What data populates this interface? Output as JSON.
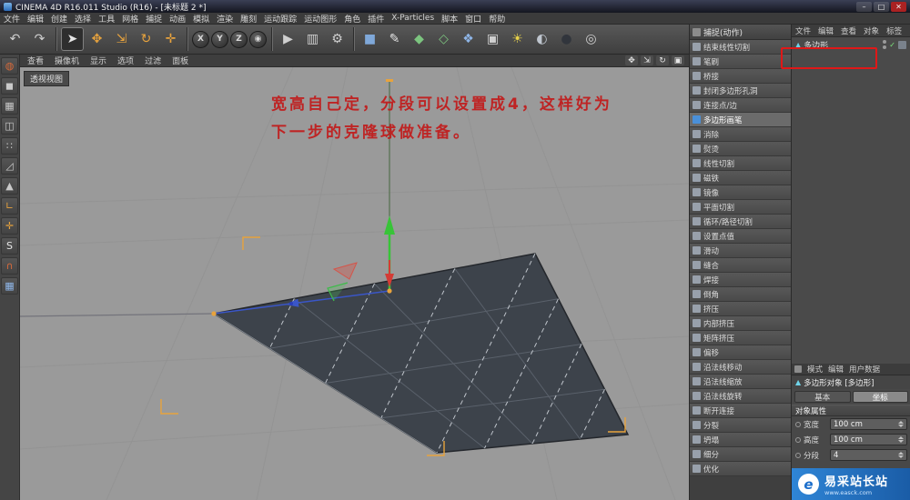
{
  "window": {
    "title": "CINEMA 4D R16.011 Studio (R16) - [未标题 2 *]",
    "minimize": "–",
    "maximize": "□",
    "close": "✕"
  },
  "menubar": {
    "items": [
      "文件",
      "编辑",
      "创建",
      "选择",
      "工具",
      "网格",
      "捕捉",
      "动画",
      "模拟",
      "渲染",
      "雕刻",
      "运动跟踪",
      "运动图形",
      "角色",
      "插件",
      "X-Particles",
      "脚本",
      "窗口",
      "帮助"
    ]
  },
  "toolbar": {
    "history": [
      {
        "name": "undo",
        "glyph": "↶",
        "color": "#cfcfcf"
      },
      {
        "name": "redo",
        "glyph": "↷",
        "color": "#cfcfcf"
      }
    ],
    "tools": [
      {
        "name": "live-selection",
        "glyph": "➤",
        "color": "#e6e6e6",
        "selected": true
      },
      {
        "name": "move",
        "glyph": "✥",
        "color": "#e8a33d"
      },
      {
        "name": "scale",
        "glyph": "⇲",
        "color": "#e8a33d"
      },
      {
        "name": "rotate",
        "glyph": "↻",
        "color": "#e8a33d"
      },
      {
        "name": "last-tool",
        "glyph": "✛",
        "color": "#e8a33d"
      }
    ],
    "axis_locks": [
      {
        "name": "lock-x",
        "glyph": "X"
      },
      {
        "name": "lock-y",
        "glyph": "Y"
      },
      {
        "name": "lock-z",
        "glyph": "Z"
      },
      {
        "name": "coordinate-system",
        "glyph": "◉"
      }
    ],
    "render": [
      {
        "name": "render-view",
        "glyph": "▶",
        "color": "#cfcfcf"
      },
      {
        "name": "render-picture-viewer",
        "glyph": "▥",
        "color": "#cfcfcf"
      },
      {
        "name": "render-settings",
        "glyph": "⚙",
        "color": "#cfcfcf"
      }
    ],
    "create": [
      {
        "name": "primitive-cube",
        "glyph": "■",
        "color": "#7fa8d9"
      },
      {
        "name": "spline-pen",
        "glyph": "✎",
        "color": "#e0e0e0"
      },
      {
        "name": "subdivision-surface",
        "glyph": "◆",
        "color": "#7cc47f"
      },
      {
        "name": "deformer",
        "glyph": "◇",
        "color": "#7cc47f"
      },
      {
        "name": "modeling",
        "glyph": "❖",
        "color": "#8fb6e8"
      },
      {
        "name": "camera",
        "glyph": "▣",
        "color": "#cfcfcf"
      },
      {
        "name": "light",
        "glyph": "☀",
        "color": "#e8d24a"
      },
      {
        "name": "environment",
        "glyph": "◐",
        "color": "#bfc6cf"
      },
      {
        "name": "material",
        "glyph": "●",
        "color": "#31353c"
      },
      {
        "name": "magnify",
        "glyph": "◎",
        "color": "#cfcfcf"
      }
    ]
  },
  "left_toolbar": {
    "buttons": [
      {
        "name": "convert-editable",
        "glyph": "◍",
        "color": "#d86a3a"
      },
      {
        "name": "model-mode",
        "glyph": "◼",
        "color": "#c9c9c9"
      },
      {
        "name": "texture-mode",
        "glyph": "▦",
        "color": "#c9c9c9"
      },
      {
        "name": "workplane-mode",
        "glyph": "◫",
        "color": "#c9c9c9"
      },
      {
        "name": "points-mode",
        "glyph": "∷",
        "color": "#c9c9c9"
      },
      {
        "name": "edges-mode",
        "glyph": "◿",
        "color": "#c9c9c9"
      },
      {
        "name": "polygons-mode",
        "glyph": "▲",
        "color": "#c9c9c9"
      },
      {
        "name": "axis-mode",
        "glyph": "∟",
        "color": "#e8a33d"
      },
      {
        "name": "coordinates-mode",
        "glyph": "✛",
        "color": "#e8a33d"
      },
      {
        "name": "snap-toggle",
        "glyph": "S",
        "color": "#e6e6e6"
      },
      {
        "name": "magnet",
        "glyph": "∩",
        "color": "#d86a3a"
      },
      {
        "name": "array-grid",
        "glyph": "▦",
        "color": "#8fb6e8"
      }
    ]
  },
  "viewport": {
    "menu": [
      "查看",
      "摄像机",
      "显示",
      "选项",
      "过滤",
      "面板"
    ],
    "controls": [
      {
        "name": "pan-view",
        "glyph": "✥"
      },
      {
        "name": "zoom-view",
        "glyph": "⇲"
      },
      {
        "name": "rotate-view",
        "glyph": "↻"
      },
      {
        "name": "toggle-view",
        "glyph": "▣"
      }
    ],
    "label": "透视视图",
    "annotation_line1": "宽高自己定，分段可以设置成4，这样好为",
    "annotation_line2": "下一步的克隆球做准备。",
    "annotation_color": "#c41414",
    "axis_colors": {
      "x": "#d43b35",
      "y": "#38c438",
      "z": "#3a56c8",
      "highlight": "#e8a33d"
    }
  },
  "commands_panel": {
    "title": "捕捉(动作)",
    "items": [
      {
        "label": "结束线性切割"
      },
      {
        "label": "笔刷"
      },
      {
        "label": "桥接"
      },
      {
        "label": "封闭多边形孔洞"
      },
      {
        "label": "连接点/边"
      },
      {
        "label": "多边形画笔",
        "active": true
      },
      {
        "label": "消除"
      },
      {
        "label": "熨烫"
      },
      {
        "label": "线性切割"
      },
      {
        "label": "磁铁"
      },
      {
        "label": "镜像"
      },
      {
        "label": "平面切割"
      },
      {
        "label": "循环/路径切割"
      },
      {
        "label": "设置点值"
      },
      {
        "label": "滑动"
      },
      {
        "label": "缝合"
      },
      {
        "label": "焊接"
      },
      {
        "label": "倒角"
      },
      {
        "label": "挤压"
      },
      {
        "label": "内部挤压"
      },
      {
        "label": "矩阵挤压"
      },
      {
        "label": "偏移"
      },
      {
        "label": "沿法线移动"
      },
      {
        "label": "沿法线缩放"
      },
      {
        "label": "沿法线旋转"
      },
      {
        "label": "断开连接"
      },
      {
        "label": "分裂"
      },
      {
        "label": "坍塌"
      },
      {
        "label": "细分"
      },
      {
        "label": "优化"
      }
    ]
  },
  "object_manager": {
    "menu": [
      "文件",
      "编辑",
      "查看",
      "对象",
      "标签"
    ],
    "object": {
      "icon": "▲",
      "name": "多边形",
      "check": "✓"
    }
  },
  "attributes": {
    "menu": [
      "模式",
      "编辑",
      "用户数据"
    ],
    "object_icon": "▲",
    "object_title": "多边形对象 [多边形]",
    "tabs": [
      {
        "label": "基本"
      },
      {
        "label": "坐标",
        "active": true
      }
    ],
    "section": "对象属性",
    "properties": [
      {
        "label": "宽度",
        "value": "100 cm"
      },
      {
        "label": "高度",
        "value": "100 cm"
      },
      {
        "label": "分段",
        "value": "4"
      }
    ]
  },
  "watermark": {
    "logo_letter": "e",
    "title": "易采站长站",
    "subtitle": "www.easck.com"
  }
}
